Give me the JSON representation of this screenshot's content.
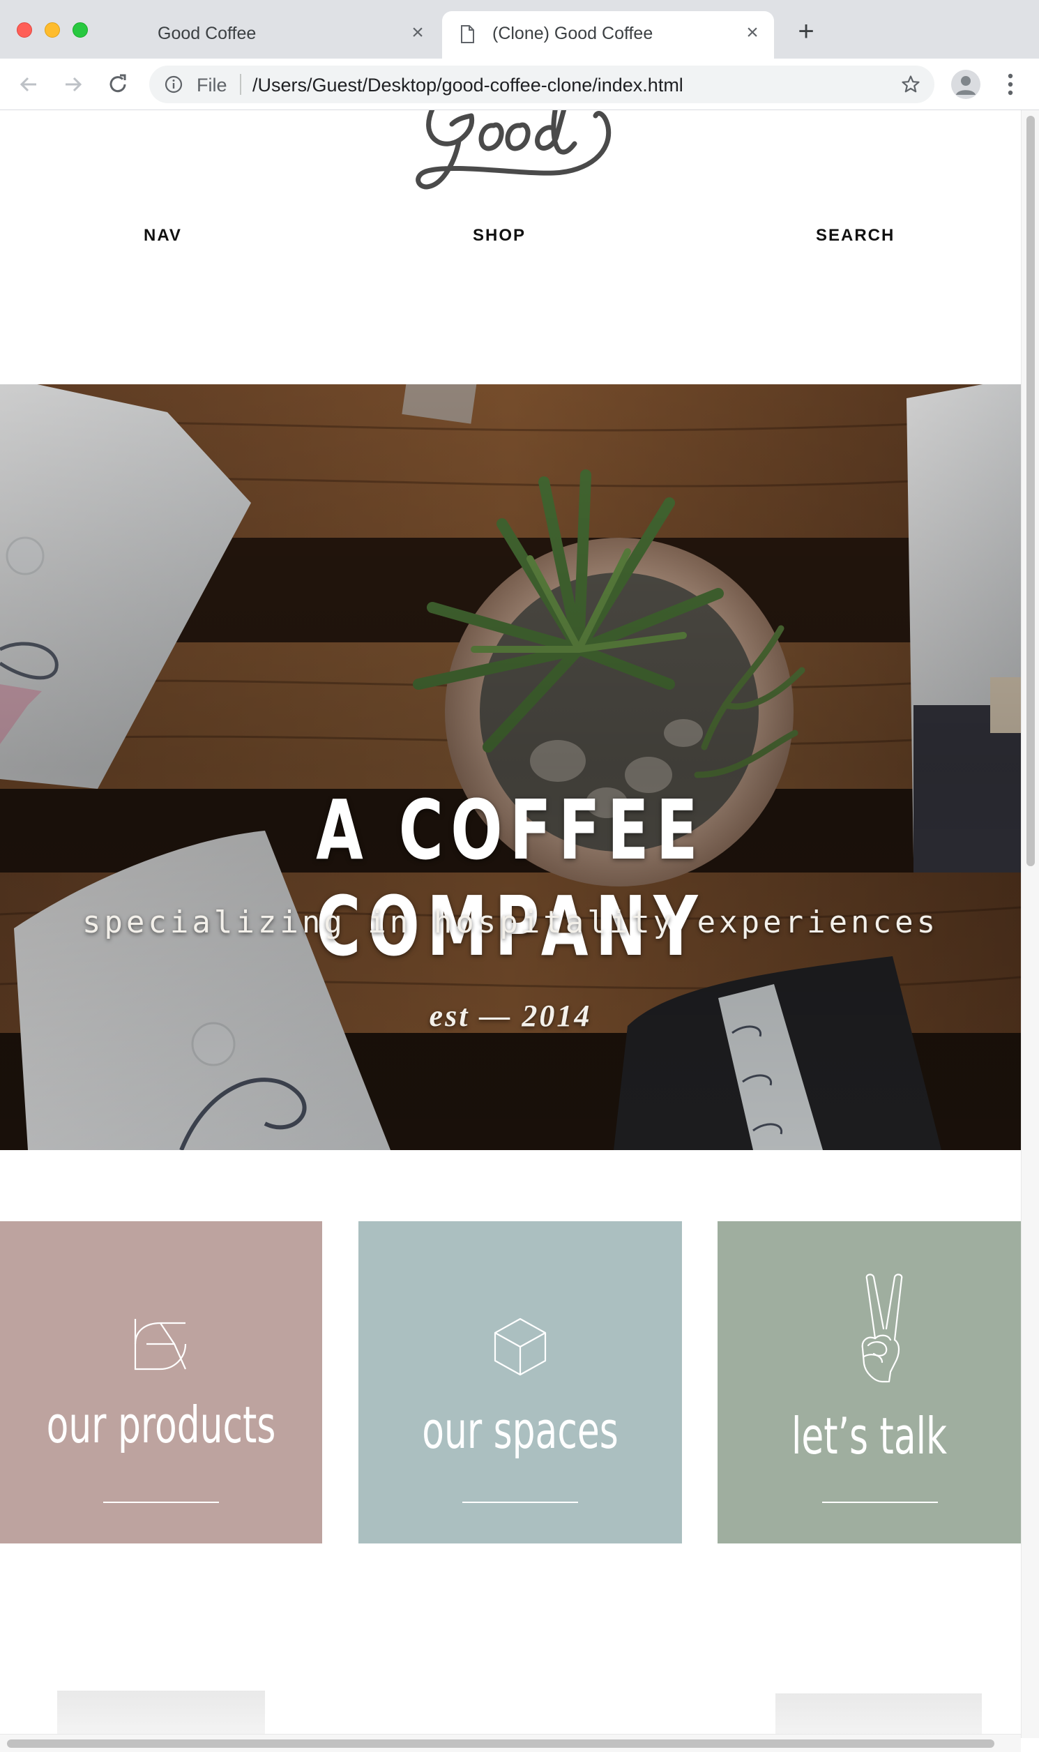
{
  "browser": {
    "tabs": [
      {
        "title": "Good Coffee",
        "active": false
      },
      {
        "title": "(Clone) Good Coffee",
        "active": true
      }
    ],
    "new_tab_symbol": "+",
    "close_symbol": "×",
    "address_bar": {
      "scheme_label": "File",
      "url": "/Users/Guest/Desktop/good-coffee-clone/index.html"
    },
    "icons": [
      "back-icon",
      "forward-icon",
      "reload-icon",
      "info-icon",
      "star-icon",
      "profile-icon",
      "menu-icon"
    ]
  },
  "site": {
    "logo_text": "Good",
    "nav": {
      "left": "NAV",
      "center": "SHOP",
      "right": "SEARCH"
    },
    "hero": {
      "title": "A COFFEE COMPANY",
      "subtitle": "specializing in hospitality experiences",
      "established": "est — 2014"
    },
    "tiles": [
      {
        "label": "our products",
        "icon": "products-icon",
        "color": "#bda39f"
      },
      {
        "label": "our spaces",
        "icon": "cube-icon",
        "color": "#abbfc0"
      },
      {
        "label": "let’s talk",
        "icon": "peace-hand-icon",
        "color": "#9fae9f"
      }
    ]
  }
}
